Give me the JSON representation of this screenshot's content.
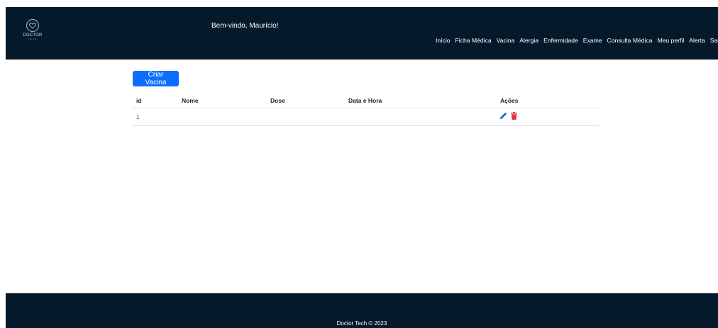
{
  "header": {
    "logo_text": "DOCTOR",
    "logo_sub": "TECH",
    "welcome": "Bem-vindo, Maurício!",
    "nav": [
      "Início",
      "Ficha Médica",
      "Vacina",
      "Alergia",
      "Enfermidade",
      "Exame",
      "Consulta Médica",
      "Meu perfil",
      "Alerta",
      "Sai"
    ]
  },
  "main": {
    "create_button": "Criar Vacina",
    "table": {
      "headers": {
        "id": "id",
        "nome": "Nome",
        "dose": "Dose",
        "data": "Data e Hora",
        "acoes": "Ações"
      },
      "rows": [
        {
          "id": "1",
          "nome": "",
          "dose": "",
          "data": ""
        }
      ]
    },
    "icons": {
      "edit": "pencil-icon",
      "delete": "trash-icon"
    }
  },
  "footer": {
    "text": "Doctor Tech © 2023"
  },
  "colors": {
    "header_bg": "#04192a",
    "primary": "#0d6efd",
    "edit": "#0b5ed7",
    "delete": "#dc3545"
  }
}
